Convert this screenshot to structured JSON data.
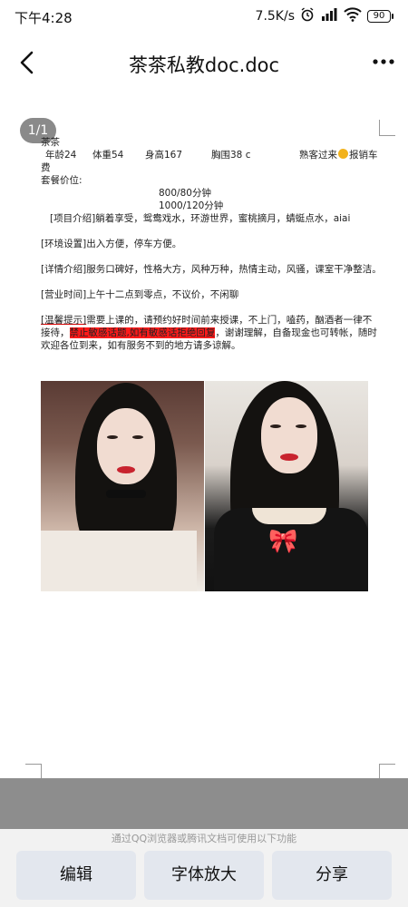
{
  "status_bar": {
    "time": "下午4:28",
    "network_speed": "7.5K/s",
    "battery": "90",
    "icons": [
      "alarm-icon",
      "signal-hd-icon",
      "wifi-icon",
      "battery-icon"
    ]
  },
  "header": {
    "title": "茶茶私教doc.doc"
  },
  "document": {
    "page_indicator": "1/1",
    "name_line": "茶茶",
    "stats": {
      "age": "年龄24",
      "weight": "体重54",
      "height": "身高167",
      "bust": "胸围38 c",
      "regular": "熟客过来",
      "reimburse": "报销车"
    },
    "fee_wrap": "费",
    "package_label": "套餐价位:",
    "price_1": "800/80分钟",
    "price_2": "1000/120分钟",
    "project": "[项目介绍]躺着享受，鸳鸯戏水，环游世界，蜜桃摘月，蜻蜓点水，aiai",
    "environment": "[环境设置]出入方便，停车方便。",
    "details": "[详情介绍]服务口碑好，性格大方，风种万种，热情主动，风骚，课室干净整洁。",
    "hours": "[营业时间]上午十二点到零点，不议价，不闲聊",
    "reminder_tag": "[温馨提示]",
    "reminder_1": "需要上课的，请预约好时间前来授课，不上门，嗑药，酗酒者一律不",
    "reminder_2a": "接待，",
    "reminder_2_highlight": "禁止敏感话题,如有敏感话拒绝回复",
    "reminder_2b": "，谢谢理解，自备现金也可转帐，随时",
    "reminder_3": "欢迎各位到来，如有服务不到的地方请多谅解。"
  },
  "toolbar": {
    "hint": "通过QQ浏览器或腾讯文档可使用以下功能",
    "edit_label": "编辑",
    "font_label": "字体放大",
    "share_label": "分享"
  },
  "colors": {
    "highlight": "#ff1a1a",
    "button_bg": "#e3e7ee",
    "gray_band": "#8d8d8d",
    "page_badge": "#8a8a8a"
  }
}
